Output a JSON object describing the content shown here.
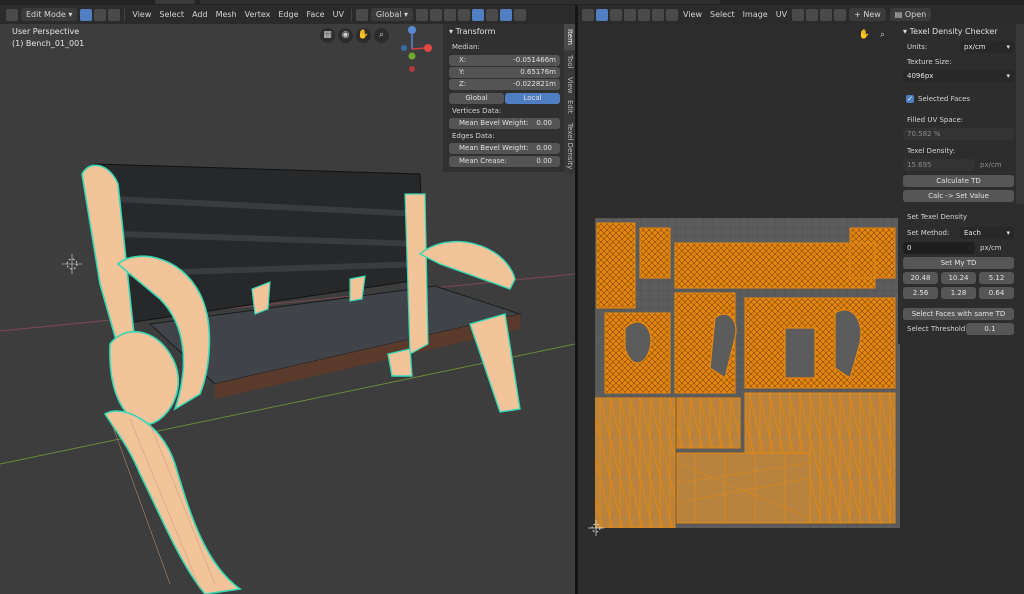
{
  "top_header": {
    "left": {
      "mode_label": "Edit Mode",
      "menus": [
        "View",
        "Select",
        "Add",
        "Mesh",
        "Vertex",
        "Edge",
        "Face",
        "UV"
      ],
      "orientation_label": "Global"
    },
    "right": {
      "menus": [
        "View",
        "Select",
        "Image",
        "UV"
      ],
      "new_label": "New",
      "open_label": "Open"
    }
  },
  "viewport3d": {
    "perspective_label": "User Perspective",
    "object_label": "(1) Bench_01_001",
    "gizmo": {
      "x": "X",
      "y": "Y",
      "z": "Z"
    }
  },
  "transform_panel": {
    "title": "Transform",
    "median_label": "Median:",
    "x_label": "X:",
    "x_value": "-0.051466m",
    "y_label": "Y:",
    "y_value": "0.65176m",
    "z_label": "Z:",
    "z_value": "-0.022821m",
    "global_label": "Global",
    "local_label": "Local",
    "vertices_data_label": "Vertices Data:",
    "vert_bevel_label": "Mean Bevel Weight:",
    "vert_bevel_value": "0.00",
    "edges_data_label": "Edges Data:",
    "edge_bevel_label": "Mean Bevel Weight:",
    "edge_bevel_value": "0.00",
    "crease_label": "Mean Crease:",
    "crease_value": "0.00"
  },
  "side_tabs": [
    "Item",
    "Tool",
    "View",
    "Edit",
    "Texel Density"
  ],
  "td_panel": {
    "title": "Texel Density Checker",
    "units_label": "Units:",
    "units_value": "px/cm",
    "texture_size_label": "Texture Size:",
    "texture_size_value": "4096px",
    "selected_faces_label": "Selected Faces",
    "filled_uv_label": "Filled UV Space:",
    "filled_uv_value": "70.582 %",
    "texel_density_label": "Texel Density:",
    "texel_density_value": "15.695",
    "texel_density_unit": "px/cm",
    "calculate_label": "Calculate TD",
    "calc_set_label": "Calc -> Set Value",
    "set_td_header": "Set Texel Density",
    "set_method_label": "Set Method:",
    "set_method_value": "Each",
    "td_input_value": "0",
    "td_input_unit": "px/cm",
    "set_my_td_label": "Set My TD",
    "presets": [
      "20.48",
      "10.24",
      "5.12",
      "2.56",
      "1.28",
      "0.64"
    ],
    "select_same_label": "Select Faces with same TD",
    "threshold_label": "Select Threshold:",
    "threshold_value": "0.1"
  },
  "colors": {
    "uv_orange": "#e5870f",
    "mesh_skin": "#f3c39a",
    "edge_teal": "#35d8b4",
    "accent_blue": "#4f7ec2",
    "viewport_bg": "#3d3d3d"
  }
}
